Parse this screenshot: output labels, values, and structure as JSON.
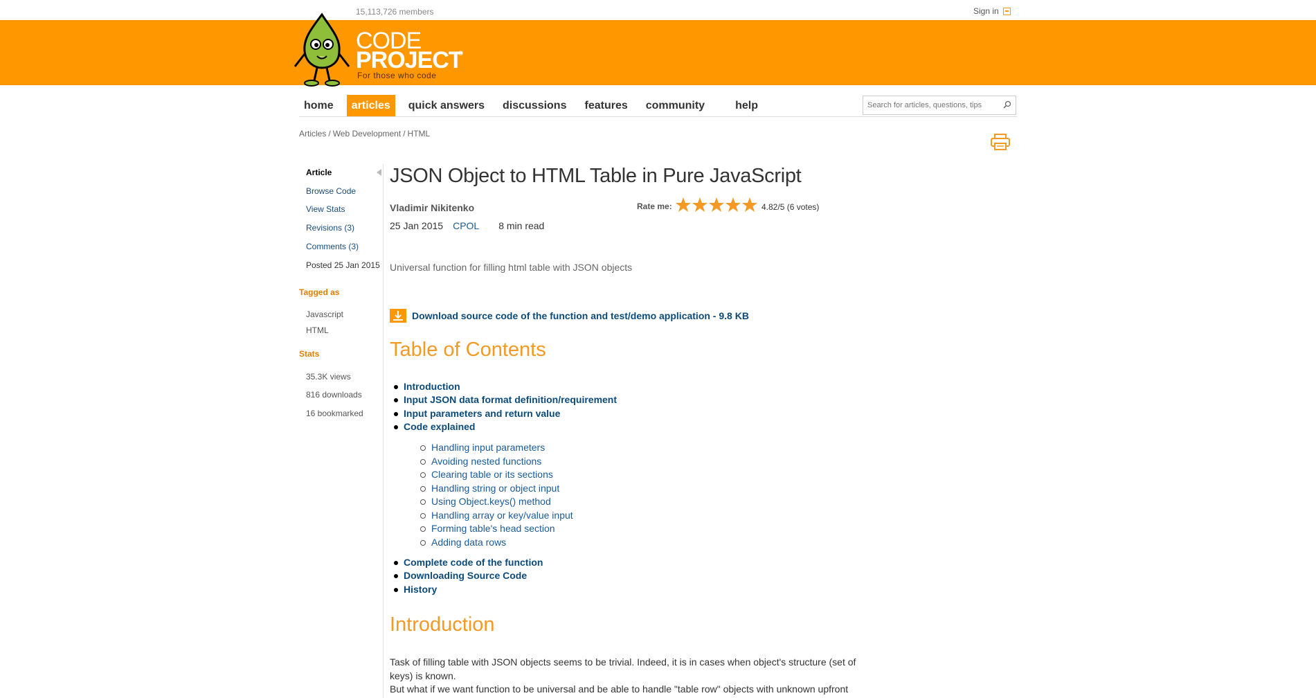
{
  "header": {
    "members": "15,113,726 members",
    "sign_in": "Sign in",
    "logo_line1": "CODE",
    "logo_line2": "PROJECT",
    "logo_reg": "®",
    "logo_tagline": "For those who code"
  },
  "nav": {
    "items": [
      "home",
      "articles",
      "quick answers",
      "discussions",
      "features",
      "community",
      "help"
    ],
    "active": "articles",
    "search_placeholder": "Search for articles, questions, tips"
  },
  "breadcrumb": [
    "Articles",
    "Web Development",
    "HTML"
  ],
  "sidebar": {
    "article": "Article",
    "browse_code": "Browse Code",
    "view_stats": "View Stats",
    "revisions": "Revisions (3)",
    "comments": "Comments (3)",
    "posted": "Posted 25 Jan 2015",
    "tagged_as_heading": "Tagged as",
    "tags": [
      "Javascript",
      "HTML"
    ],
    "stats_heading": "Stats",
    "stats": [
      "35.3K views",
      "816 downloads",
      "16 bookmarked"
    ]
  },
  "article": {
    "title": "JSON Object to HTML Table in Pure JavaScript",
    "author": "Vladimir Nikitenko",
    "date": "25 Jan 2015",
    "license": "CPOL",
    "read_time": "8 min read",
    "rate_label": "Rate me:",
    "rating_value": 4.82,
    "rating_max": 5,
    "rating_text": "4.82/5 (6 votes)",
    "summary": "Universal function for filling html table with JSON objects",
    "download_label": "Download source code of the function and test/demo application - 9.8 KB",
    "toc_heading": "Table of Contents",
    "toc": [
      "Introduction",
      "Input JSON data format definition/requirement",
      "Input parameters and return value",
      "Code explained"
    ],
    "toc_sub": [
      "Handling input parameters",
      "Avoiding nested functions",
      "Clearing table or its sections",
      "Handling string or object input",
      "Using Object.keys() method",
      "Handling array or key/value input",
      "Forming table's head section",
      "Adding data rows"
    ],
    "toc_after": [
      "Complete code of the function",
      "Downloading Source Code",
      "History"
    ],
    "intro_heading": "Introduction",
    "intro_line1": "Task of filling table with JSON objects seems to be trivial. Indeed, it is in cases when object's structure (set of",
    "intro_line2": "keys) is known.",
    "intro_line3": "But what if we want function to be universal and be able to handle \"table row\" objects with unknown upfront"
  },
  "colors": {
    "brand_orange": "#ff9800",
    "link_blue": "#0b4a7a",
    "heading_orange": "#f39a24"
  }
}
